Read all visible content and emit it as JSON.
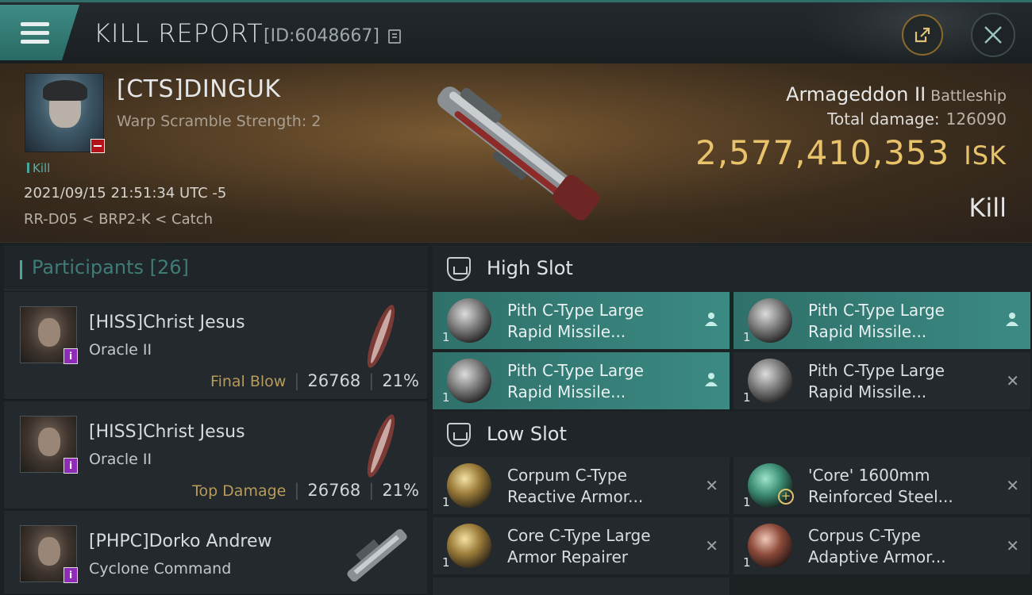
{
  "header": {
    "title": "KILL REPORT",
    "report_id": "[ID:6048667]"
  },
  "victim": {
    "name": "[CTS]DINGUK",
    "subtitle": "Warp Scramble Strength: 2",
    "tag": "Kill",
    "datetime": "2021/09/15 21:51:34 UTC -5",
    "location": "RR-D05 < BRP2-K < Catch",
    "ship": "Armageddon II",
    "ship_class": "Battleship",
    "total_damage_label": "Total damage:",
    "total_damage": "126090",
    "isk_value": "2,577,410,353",
    "isk_unit": "ISK",
    "result": "Kill"
  },
  "participants": {
    "label": "Participants",
    "count": "[26]",
    "rows": [
      {
        "name": "[HISS]Christ Jesus",
        "ship": "Oracle II",
        "tag": "Final Blow",
        "damage": "26768",
        "percent": "21%"
      },
      {
        "name": "[HISS]Christ Jesus",
        "ship": "Oracle II",
        "tag": "Top Damage",
        "damage": "26768",
        "percent": "21%"
      },
      {
        "name": "[PHPC]Dorko Andrew",
        "ship": "Cyclone Command",
        "tag": "",
        "damage": "",
        "percent": ""
      }
    ]
  },
  "slots": {
    "high": {
      "label": "High Slot",
      "modules": [
        {
          "name": "Pith C-Type Large Rapid Missile...",
          "line1": "Pith C-Type Large",
          "line2": "Rapid Missile...",
          "qty": "1",
          "status": "person-icon"
        },
        {
          "name": "Pith C-Type Large Rapid Missile...",
          "line1": "Pith C-Type Large",
          "line2": "Rapid Missile...",
          "qty": "1",
          "status": "person-icon"
        },
        {
          "name": "Pith C-Type Large Rapid Missile...",
          "line1": "Pith C-Type Large",
          "line2": "Rapid Missile...",
          "qty": "1",
          "status": "person-icon"
        },
        {
          "name": "Pith C-Type Large Rapid Missile...",
          "line1": "Pith C-Type Large",
          "line2": "Rapid Missile...",
          "qty": "1",
          "status": "destroyed-x-icon"
        }
      ]
    },
    "low": {
      "label": "Low Slot",
      "modules": [
        {
          "line1": "Corpum C-Type",
          "line2": "Reactive Armor...",
          "qty": "1",
          "status": "destroyed-x-icon"
        },
        {
          "line1": "'Core' 1600mm",
          "line2": "Reinforced Steel...",
          "qty": "1",
          "status": "destroyed-x-icon"
        },
        {
          "line1": "Core C-Type Large",
          "line2": "Armor Repairer",
          "qty": "1",
          "status": "destroyed-x-icon"
        },
        {
          "line1": "Corpus C-Type",
          "line2": "Adaptive Armor...",
          "qty": "1",
          "status": "destroyed-x-icon"
        }
      ]
    }
  },
  "colors": {
    "accent_teal": "#3b8a83",
    "isk_gold": "#e8c36a",
    "destroyed_badge": "#b3141a"
  }
}
